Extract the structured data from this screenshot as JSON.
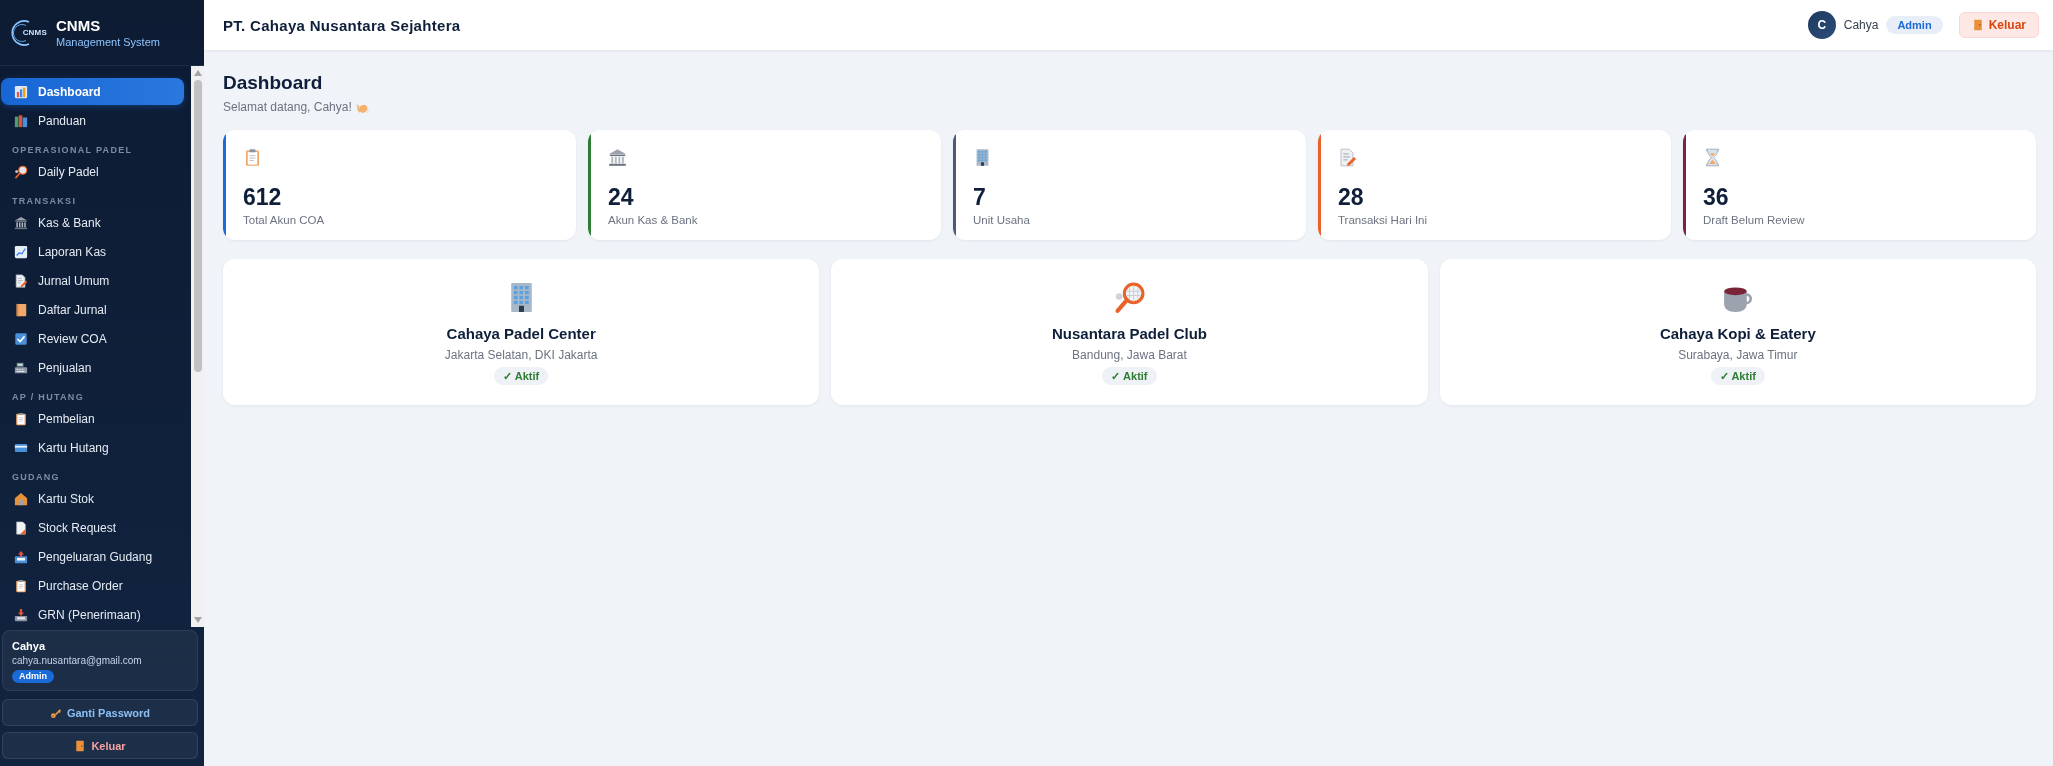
{
  "sidebar": {
    "logo_mark": "CNMS",
    "brand": "CNMS",
    "subtitle": "Management System",
    "nav": [
      {
        "items": [
          {
            "label": "Dashboard",
            "selected": true
          },
          {
            "label": "Panduan",
            "selected": false
          }
        ]
      },
      {
        "heading": "OPERASIONAL PADEL",
        "items": [
          {
            "label": "Daily Padel",
            "selected": false
          }
        ]
      },
      {
        "heading": "TRANSAKSI",
        "items": [
          {
            "label": "Kas & Bank",
            "selected": false
          },
          {
            "label": "Laporan Kas",
            "selected": false
          },
          {
            "label": "Jurnal Umum",
            "selected": false
          },
          {
            "label": "Daftar Jurnal",
            "selected": false
          },
          {
            "label": "Review COA",
            "selected": false
          },
          {
            "label": "Penjualan",
            "selected": false
          }
        ]
      },
      {
        "heading": "AP / HUTANG",
        "items": [
          {
            "label": "Pembelian",
            "selected": false
          },
          {
            "label": "Kartu Hutang",
            "selected": false
          }
        ]
      },
      {
        "heading": "GUDANG",
        "items": [
          {
            "label": "Kartu Stok",
            "selected": false
          },
          {
            "label": "Stock Request",
            "selected": false
          },
          {
            "label": "Pengeluaran Gudang",
            "selected": false
          },
          {
            "label": "Purchase Order",
            "selected": false
          },
          {
            "label": "GRN (Penerimaan)",
            "selected": false
          }
        ]
      }
    ],
    "user": {
      "name": "Cahya",
      "email": "cahya.nusantara@gmail.com",
      "role": "Admin"
    },
    "actions": [
      {
        "kind": "password",
        "label": "Ganti Password"
      },
      {
        "kind": "logout",
        "label": "Keluar"
      }
    ]
  },
  "header": {
    "title": "PT. Cahaya Nusantara Sejahtera",
    "avatar_initial": "C",
    "user_name": "Cahya",
    "role": "Admin",
    "logout": "Keluar"
  },
  "page": {
    "title": "Dashboard",
    "greeting": "Selamat datang, Cahya!"
  },
  "stats": [
    {
      "value": "612",
      "label": "Total Akun COA",
      "color": "#1a6ad8"
    },
    {
      "value": "24",
      "label": "Akun Kas & Bank",
      "color": "#2e7d32"
    },
    {
      "value": "7",
      "label": "Unit Usaha",
      "color": "#4b5a78"
    },
    {
      "value": "28",
      "label": "Transaksi Hari Ini",
      "color": "#e8622a"
    },
    {
      "value": "36",
      "label": "Draft Belum Review",
      "color": "#7b2341"
    }
  ],
  "units": [
    {
      "name": "Cahaya Padel Center",
      "location": "Jakarta Selatan, DKI Jakarta",
      "status": "✓ Aktif"
    },
    {
      "name": "Nusantara Padel Club",
      "location": "Bandung, Jawa Barat",
      "status": "✓ Aktif"
    },
    {
      "name": "Cahaya Kopi & Eatery",
      "location": "Surabaya, Jawa Timur",
      "status": "✓ Aktif"
    }
  ]
}
